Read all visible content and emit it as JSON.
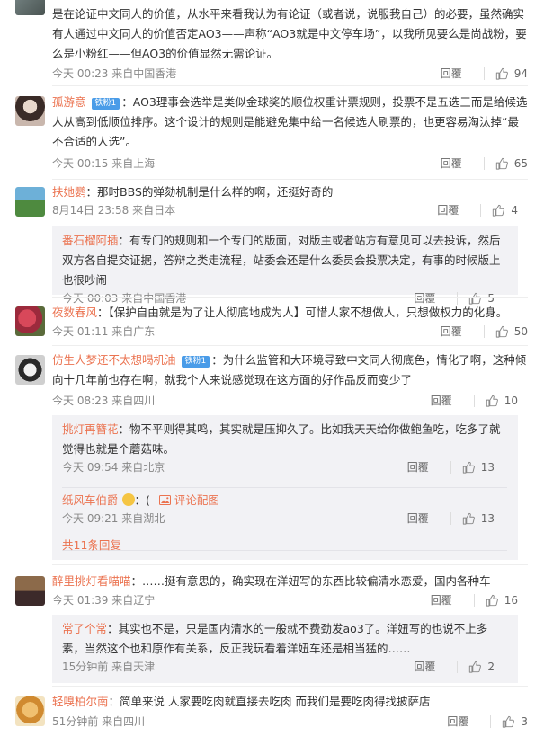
{
  "colors": {
    "username": "#eb7350",
    "badge": "#4a9ce8",
    "sub_bg": "#f2f2f5"
  },
  "icons": {
    "like": "thumb-up-icon",
    "badge": "fan-badge-icon",
    "review": "image-icon"
  },
  "comments": [
    {
      "text": "是在论证中文同人的价值，从水平来看我认为有论证（或者说，说服我自己）的必要，虽然确实有人通过中文同人的价值否定AO3——声称“AO3就是中文停车场”，以我所见要么是尚战粉，要么是小粉红——但AO3的价值显然无需论证。",
      "time": "今天 00:23 来自中国香港",
      "reply": "回覆",
      "likes": "94"
    },
    {
      "user": "孤游意",
      "badge": "铁粉1",
      "text": "：AO3理事会选举是类似金球奖的顺位权重计票规则，投票不是五选三而是给候选人从高到低顺位排序。这个设计的规则是能避免集中给一名候选人刷票的，也更容易淘汰掉“最不合适的人选”。",
      "time": "今天 00:15 来自上海",
      "reply": "回覆",
      "likes": "65"
    },
    {
      "user": "扶她鹦",
      "text": "：那时BBS的弹劾机制是什么样的啊，还挺好奇的",
      "time": "8月14日 23:58 来自日本",
      "reply": "回覆",
      "likes": "4",
      "subs": [
        {
          "user": "番石榴阿插",
          "text": "：有专门的规则和一个专门的版面，对版主或者站方有意见可以去投诉，然后双方各自提交证据，答辩之类走流程，站委会还是什么委员会投票决定，有事的时候版上也很吵闹",
          "time": "今天 00:03 来自中国香港",
          "reply": "回覆",
          "likes": "5"
        }
      ]
    },
    {
      "user": "夜数春风",
      "text": "：【保护自由就是为了让人彻底地成为人】可惜人家不想做人，只想做权力的化身。",
      "time": "今天 01:11 来自广东",
      "reply": "回覆",
      "likes": "50"
    },
    {
      "user": "仿生人梦还不太想喝机油",
      "badge": "铁粉1",
      "text": "：为什么监管和大环境导致中文同人彻底色，情化了啊，这种倾向十几年前也存在啊，就我个人来说感觉现在这方面的好作品反而变少了",
      "time": "今天 08:23 来自四川",
      "reply": "回覆",
      "likes": "10",
      "subs": [
        {
          "user": "挑灯再簪花",
          "text": "：物不平则得其鸣，其实就是压抑久了。比如我天天给你做鲍鱼吃，吃多了就觉得也就是个蘑菇味。",
          "time": "今天 09:54 来自北京",
          "reply": "回覆",
          "likes": "13"
        },
        {
          "user": "纸风车伯爵",
          "text": "：(",
          "review": "评论配图",
          "time": "今天 09:21 来自湖北",
          "reply": "回覆",
          "likes": "13"
        }
      ],
      "more": "共11条回复"
    },
    {
      "user": "醉里挑灯看喵喵",
      "text": "：……挺有意思的，确实现在洋妞写的东西比较偏清水恋爱，国内各种车",
      "time": "今天 01:39 来自辽宁",
      "reply": "回覆",
      "likes": "16",
      "subs": [
        {
          "user": "常了个常",
          "text": "：其实也不是，只是国内清水的一般就不费劲发ao3了。洋妞写的也说不上多素，当然这个也和原作有关系，反正我玩看着洋妞车还是相当猛的……",
          "time": "15分钟前 来自天津",
          "reply": "回覆",
          "likes": "2"
        }
      ]
    },
    {
      "user": "轻嗅柏尔南",
      "text": "：简单来说 人家要吃肉就直接去吃肉 而我们是要吃肉得找披萨店",
      "time": "51分钟前 来自四川",
      "reply": "回覆",
      "likes": "3"
    }
  ]
}
